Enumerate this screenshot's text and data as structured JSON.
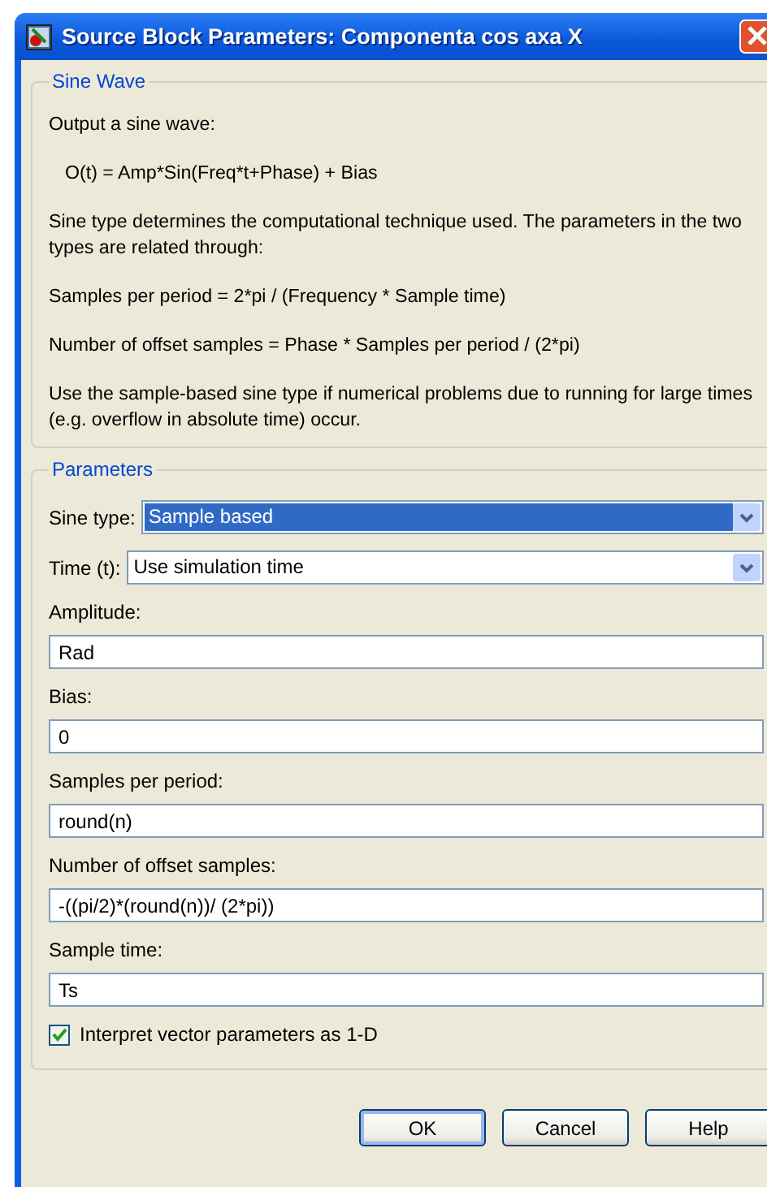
{
  "window": {
    "title": "Source Block Parameters: Componenta cos axa X"
  },
  "description": {
    "title": "Sine Wave",
    "paragraphs": [
      {
        "text": "Output a sine wave:",
        "indented": false
      },
      {
        "text": "O(t) = Amp*Sin(Freq*t+Phase) + Bias",
        "indented": true
      },
      {
        "text": "Sine type determines the computational technique used. The parameters in the two types are related through:",
        "indented": false
      },
      {
        "text": "Samples per period = 2*pi / (Frequency * Sample time)",
        "indented": false
      },
      {
        "text": "Number of offset samples = Phase * Samples per period / (2*pi)",
        "indented": false
      },
      {
        "text": "Use the sample-based sine type if numerical problems due to running for large times (e.g. overflow in absolute time) occur.",
        "indented": false
      }
    ]
  },
  "parameters": {
    "title": "Parameters",
    "items": [
      {
        "kind": "dropdown",
        "label": "Sine type:",
        "value": "Sample based",
        "highlighted": true
      },
      {
        "kind": "dropdown",
        "label": "Time (t):",
        "value": "Use simulation time",
        "highlighted": false
      },
      {
        "kind": "text",
        "label": "Amplitude:",
        "value": "Rad"
      },
      {
        "kind": "text",
        "label": "Bias:",
        "value": "0"
      },
      {
        "kind": "text",
        "label": "Samples per period:",
        "value": "round(n)"
      },
      {
        "kind": "text",
        "label": "Number of offset samples:",
        "value": "-((pi/2)*(round(n))/ (2*pi))"
      },
      {
        "kind": "text",
        "label": "Sample time:",
        "value": "Ts"
      },
      {
        "kind": "checkbox",
        "label": "Interpret vector parameters as 1-D",
        "checked": true
      }
    ]
  },
  "buttons": [
    {
      "label": "OK",
      "default": true
    },
    {
      "label": "Cancel",
      "default": false
    },
    {
      "label": "Help",
      "default": false
    }
  ]
}
